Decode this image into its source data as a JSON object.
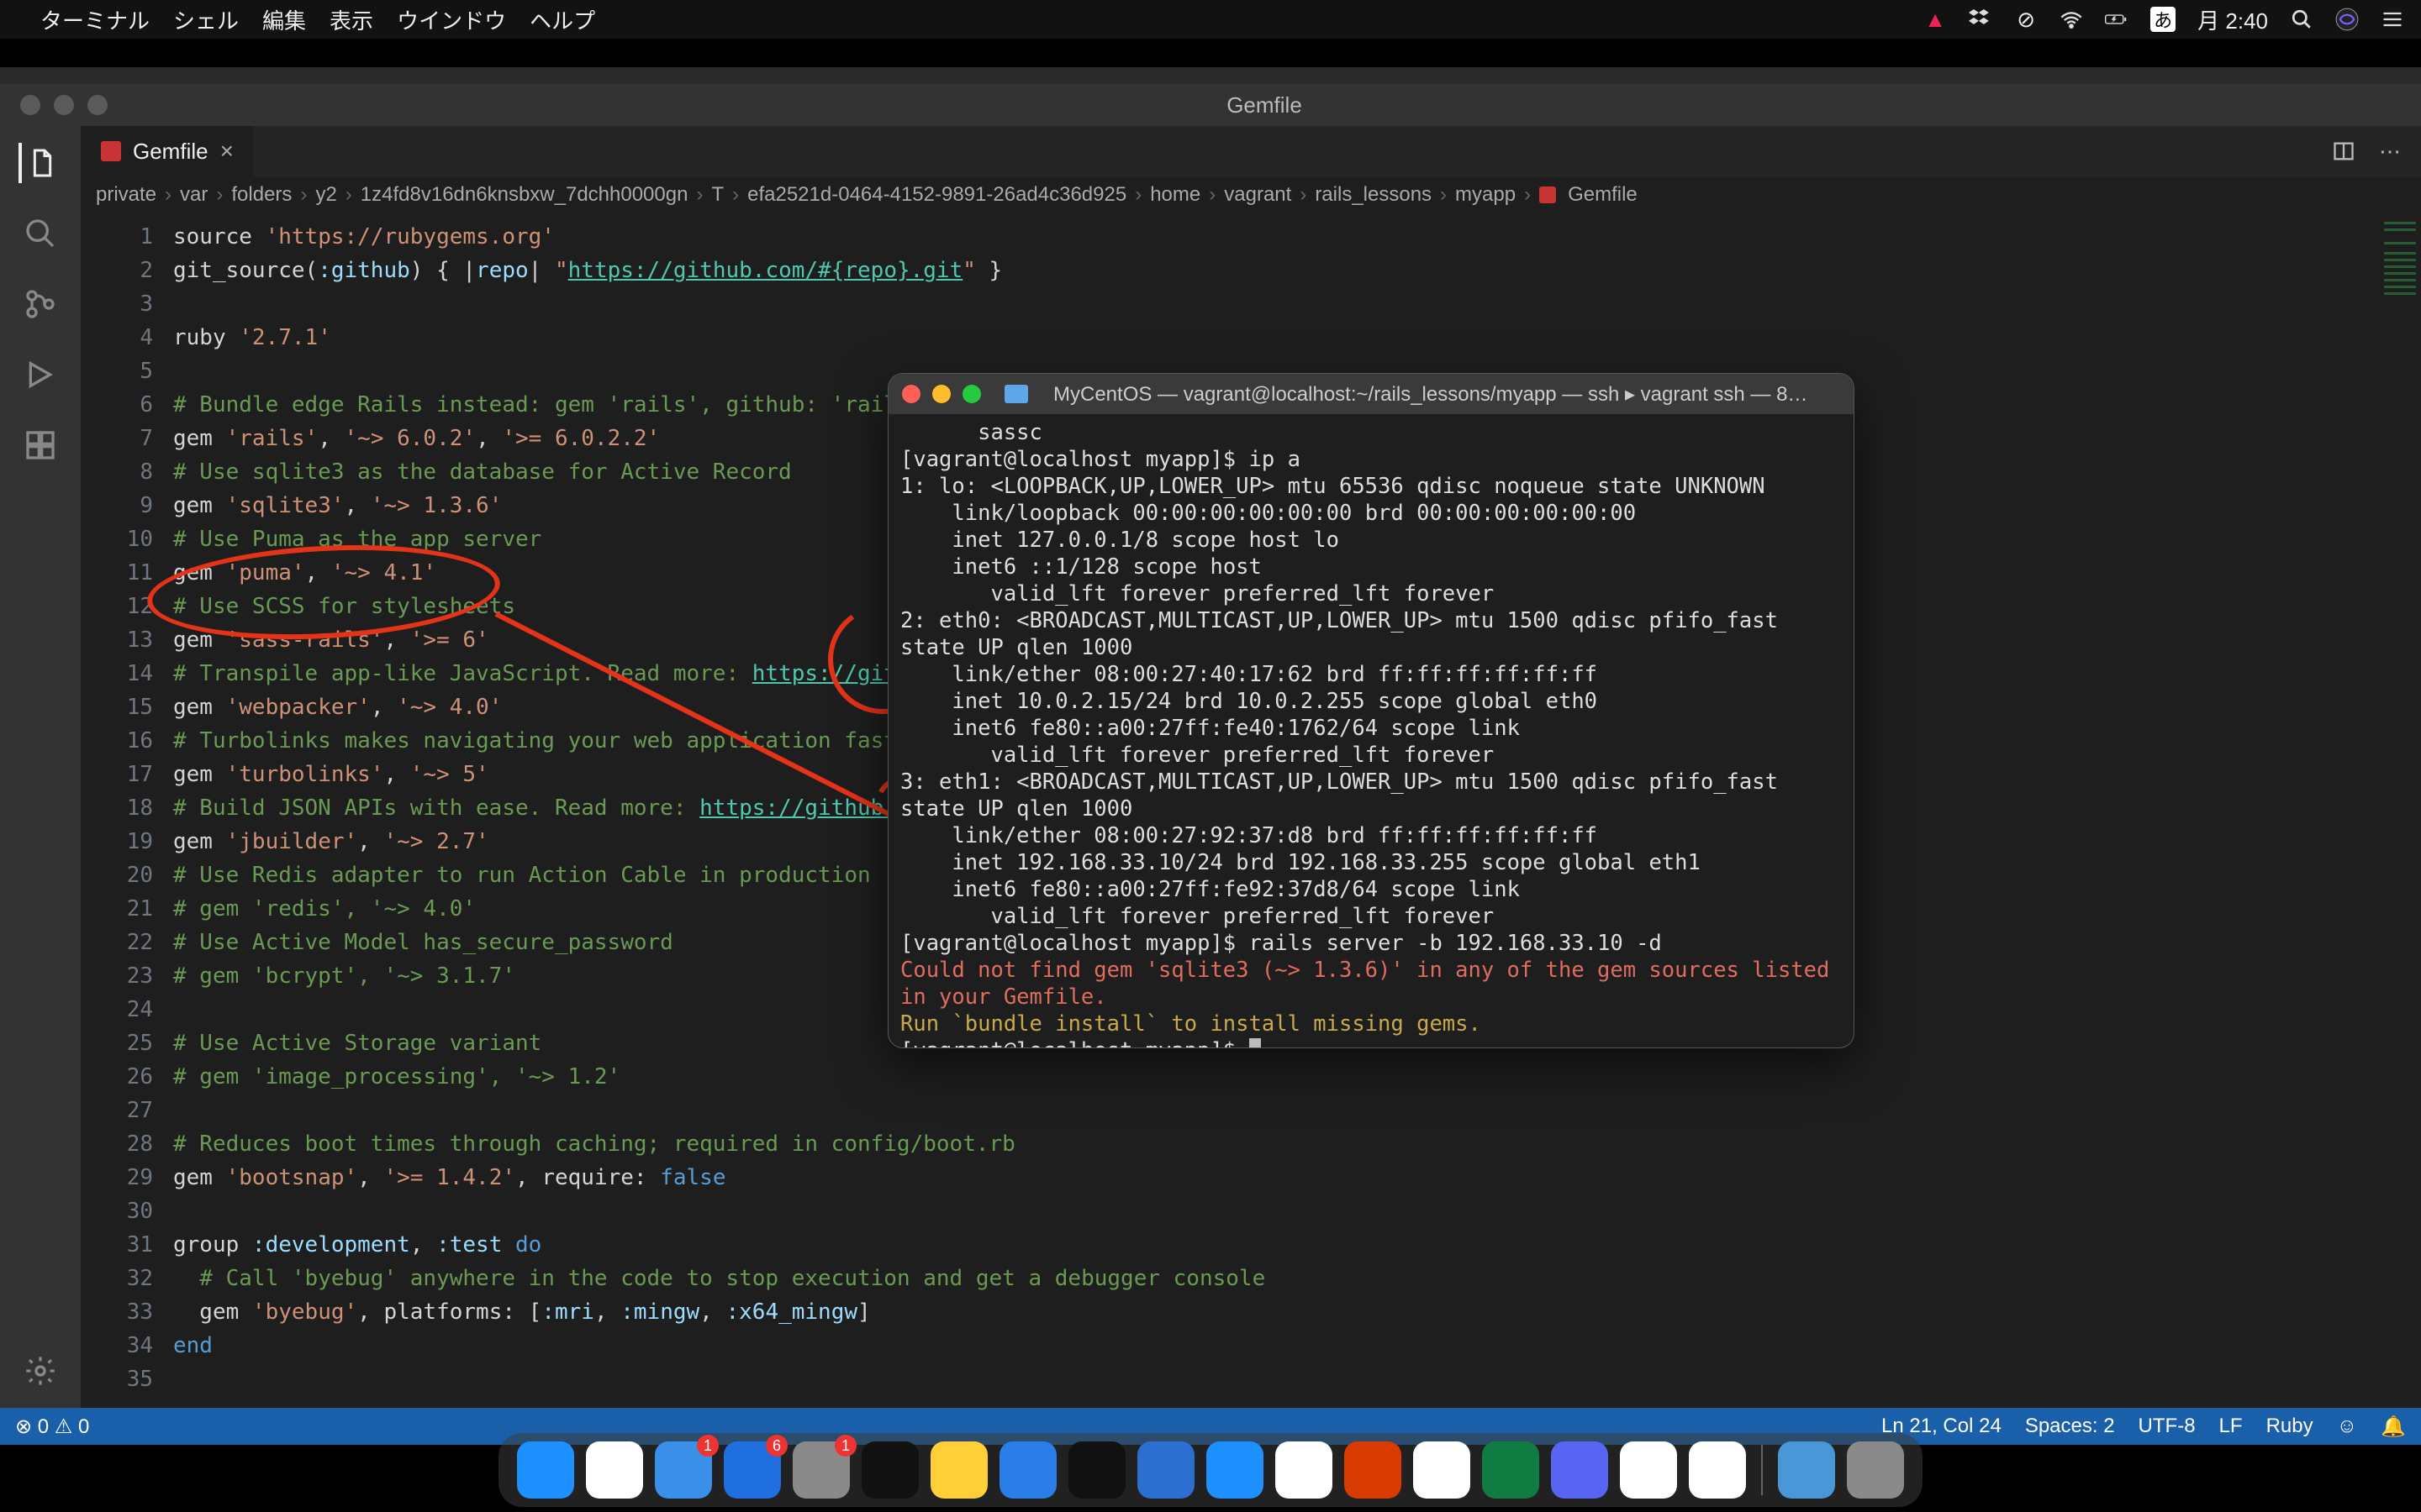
{
  "menubar": {
    "app": "ターミナル",
    "items": [
      "シェル",
      "編集",
      "表示",
      "ウインドウ",
      "ヘルプ"
    ],
    "clock": "月 2:40",
    "input_indicator": "あ"
  },
  "vscode": {
    "window_title": "Gemfile",
    "tab": {
      "label": "Gemfile"
    },
    "breadcrumb": [
      "private",
      "var",
      "folders",
      "y2",
      "1z4fd8v16dn6knsbxw_7dchh0000gn",
      "T",
      "efa2521d-0464-4152-9891-26ad4c36d925",
      "home",
      "vagrant",
      "rails_lessons",
      "myapp",
      "Gemfile"
    ],
    "code_lines": [
      {
        "n": 1,
        "segs": [
          [
            "sym",
            "source "
          ],
          [
            "str",
            "'https://rubygems.org'"
          ]
        ]
      },
      {
        "n": 2,
        "segs": [
          [
            "sym",
            "git_source("
          ],
          [
            "con",
            ":github"
          ],
          [
            "sym",
            ") { |"
          ],
          [
            "con",
            "repo"
          ],
          [
            "sym",
            "| "
          ],
          [
            "str",
            "\""
          ],
          [
            "link",
            "https://github.com/#{repo}.git"
          ],
          [
            "str",
            "\""
          ],
          [
            "sym",
            " }"
          ]
        ]
      },
      {
        "n": 3,
        "segs": [
          [
            "sym",
            ""
          ]
        ]
      },
      {
        "n": 4,
        "segs": [
          [
            "sym",
            "ruby "
          ],
          [
            "str",
            "'2.7.1'"
          ]
        ]
      },
      {
        "n": 5,
        "segs": [
          [
            "sym",
            ""
          ]
        ]
      },
      {
        "n": 6,
        "segs": [
          [
            "cmt",
            "# Bundle edge Rails instead: gem 'rails', github: 'rails/r"
          ]
        ]
      },
      {
        "n": 7,
        "segs": [
          [
            "sym",
            "gem "
          ],
          [
            "str",
            "'rails'"
          ],
          [
            "sym",
            ", "
          ],
          [
            "str",
            "'~> 6.0.2'"
          ],
          [
            "sym",
            ", "
          ],
          [
            "str",
            "'>= 6.0.2.2'"
          ]
        ]
      },
      {
        "n": 8,
        "segs": [
          [
            "cmt",
            "# Use sqlite3 as the database for Active Record"
          ]
        ]
      },
      {
        "n": 9,
        "segs": [
          [
            "sym",
            "gem "
          ],
          [
            "str",
            "'sqlite3'"
          ],
          [
            "sym",
            ", "
          ],
          [
            "str",
            "'~> 1.3.6'"
          ]
        ]
      },
      {
        "n": 10,
        "segs": [
          [
            "cmt",
            "# Use Puma as the app server"
          ]
        ]
      },
      {
        "n": 11,
        "segs": [
          [
            "sym",
            "gem "
          ],
          [
            "str",
            "'puma'"
          ],
          [
            "sym",
            ", "
          ],
          [
            "str",
            "'~> 4.1'"
          ]
        ]
      },
      {
        "n": 12,
        "segs": [
          [
            "cmt",
            "# Use SCSS for stylesheets"
          ]
        ]
      },
      {
        "n": 13,
        "segs": [
          [
            "sym",
            "gem "
          ],
          [
            "str",
            "'sass-rails'"
          ],
          [
            "sym",
            ", "
          ],
          [
            "str",
            "'>= 6'"
          ]
        ]
      },
      {
        "n": 14,
        "segs": [
          [
            "cmt",
            "# Transpile app-like JavaScript. Read more: "
          ],
          [
            "link",
            "https://github.com"
          ]
        ]
      },
      {
        "n": 15,
        "segs": [
          [
            "sym",
            "gem "
          ],
          [
            "str",
            "'webpacker'"
          ],
          [
            "sym",
            ", "
          ],
          [
            "str",
            "'~> 4.0'"
          ]
        ]
      },
      {
        "n": 16,
        "segs": [
          [
            "cmt",
            "# Turbolinks makes navigating your web application faster"
          ]
        ]
      },
      {
        "n": 17,
        "segs": [
          [
            "sym",
            "gem "
          ],
          [
            "str",
            "'turbolinks'"
          ],
          [
            "sym",
            ", "
          ],
          [
            "str",
            "'~> 5'"
          ]
        ]
      },
      {
        "n": 18,
        "segs": [
          [
            "cmt",
            "# Build JSON APIs with ease. Read more: "
          ],
          [
            "link",
            "https://github.com"
          ]
        ]
      },
      {
        "n": 19,
        "segs": [
          [
            "sym",
            "gem "
          ],
          [
            "str",
            "'jbuilder'"
          ],
          [
            "sym",
            ", "
          ],
          [
            "str",
            "'~> 2.7'"
          ]
        ]
      },
      {
        "n": 20,
        "segs": [
          [
            "cmt",
            "# Use Redis adapter to run Action Cable in production"
          ]
        ]
      },
      {
        "n": 21,
        "segs": [
          [
            "cmt",
            "# gem 'redis', '~> 4.0'"
          ]
        ]
      },
      {
        "n": 22,
        "segs": [
          [
            "cmt",
            "# Use Active Model has_secure_password"
          ]
        ]
      },
      {
        "n": 23,
        "segs": [
          [
            "cmt",
            "# gem 'bcrypt', '~> 3.1.7'"
          ]
        ]
      },
      {
        "n": 24,
        "segs": [
          [
            "sym",
            ""
          ]
        ]
      },
      {
        "n": 25,
        "segs": [
          [
            "cmt",
            "# Use Active Storage variant"
          ]
        ]
      },
      {
        "n": 26,
        "segs": [
          [
            "cmt",
            "# gem 'image_processing', '~> 1.2'"
          ]
        ]
      },
      {
        "n": 27,
        "segs": [
          [
            "sym",
            ""
          ]
        ]
      },
      {
        "n": 28,
        "segs": [
          [
            "cmt",
            "# Reduces boot times through caching; required in config/boot.rb"
          ]
        ]
      },
      {
        "n": 29,
        "segs": [
          [
            "sym",
            "gem "
          ],
          [
            "str",
            "'bootsnap'"
          ],
          [
            "sym",
            ", "
          ],
          [
            "str",
            "'>= 1.4.2'"
          ],
          [
            "sym",
            ", require: "
          ],
          [
            "kw",
            "false"
          ]
        ]
      },
      {
        "n": 30,
        "segs": [
          [
            "sym",
            ""
          ]
        ]
      },
      {
        "n": 31,
        "segs": [
          [
            "sym",
            "group "
          ],
          [
            "con",
            ":development"
          ],
          [
            "sym",
            ", "
          ],
          [
            "con",
            ":test"
          ],
          [
            "sym",
            " "
          ],
          [
            "kw",
            "do"
          ]
        ]
      },
      {
        "n": 32,
        "segs": [
          [
            "sym",
            "  "
          ],
          [
            "cmt",
            "# Call 'byebug' anywhere in the code to stop execution and get a debugger console"
          ]
        ]
      },
      {
        "n": 33,
        "segs": [
          [
            "sym",
            "  gem "
          ],
          [
            "str",
            "'byebug'"
          ],
          [
            "sym",
            ", platforms: ["
          ],
          [
            "con",
            ":mri"
          ],
          [
            "sym",
            ", "
          ],
          [
            "con",
            ":mingw"
          ],
          [
            "sym",
            ", "
          ],
          [
            "con",
            ":x64_mingw"
          ],
          [
            "sym",
            "]"
          ]
        ]
      },
      {
        "n": 34,
        "segs": [
          [
            "kw",
            "end"
          ]
        ]
      },
      {
        "n": 35,
        "segs": [
          [
            "sym",
            ""
          ]
        ]
      }
    ],
    "status": {
      "errors": "0",
      "warnings": "0",
      "ln_col": "Ln 21, Col 24",
      "spaces": "Spaces: 2",
      "encoding": "UTF-8",
      "eol": "LF",
      "language": "Ruby"
    }
  },
  "terminal": {
    "title": "MyCentOS — vagrant@localhost:~/rails_lessons/myapp — ssh ▸ vagrant ssh — 8…",
    "lines": [
      {
        "cls": "",
        "t": "      sassc"
      },
      {
        "cls": "",
        "t": "[vagrant@localhost myapp]$ ip a"
      },
      {
        "cls": "",
        "t": "1: lo: <LOOPBACK,UP,LOWER_UP> mtu 65536 qdisc noqueue state UNKNOWN"
      },
      {
        "cls": "",
        "t": "    link/loopback 00:00:00:00:00:00 brd 00:00:00:00:00:00"
      },
      {
        "cls": "",
        "t": "    inet 127.0.0.1/8 scope host lo"
      },
      {
        "cls": "",
        "t": "    inet6 ::1/128 scope host"
      },
      {
        "cls": "",
        "t": "       valid_lft forever preferred_lft forever"
      },
      {
        "cls": "",
        "t": "2: eth0: <BROADCAST,MULTICAST,UP,LOWER_UP> mtu 1500 qdisc pfifo_fast state UP qlen 1000"
      },
      {
        "cls": "",
        "t": "    link/ether 08:00:27:40:17:62 brd ff:ff:ff:ff:ff:ff"
      },
      {
        "cls": "",
        "t": "    inet 10.0.2.15/24 brd 10.0.2.255 scope global eth0"
      },
      {
        "cls": "",
        "t": "    inet6 fe80::a00:27ff:fe40:1762/64 scope link"
      },
      {
        "cls": "",
        "t": "       valid_lft forever preferred_lft forever"
      },
      {
        "cls": "",
        "t": "3: eth1: <BROADCAST,MULTICAST,UP,LOWER_UP> mtu 1500 qdisc pfifo_fast state UP qlen 1000"
      },
      {
        "cls": "",
        "t": "    link/ether 08:00:27:92:37:d8 brd ff:ff:ff:ff:ff:ff"
      },
      {
        "cls": "",
        "t": "    inet 192.168.33.10/24 brd 192.168.33.255 scope global eth1"
      },
      {
        "cls": "",
        "t": "    inet6 fe80::a00:27ff:fe92:37d8/64 scope link"
      },
      {
        "cls": "",
        "t": "       valid_lft forever preferred_lft forever"
      },
      {
        "cls": "",
        "t": "[vagrant@localhost myapp]$ rails server -b 192.168.33.10 -d"
      },
      {
        "cls": "t-red",
        "t": "Could not find gem 'sqlite3 (~> 1.3.6)' in any of the gem sources listed in your Gemfile."
      },
      {
        "cls": "t-yel",
        "t": "Run `bundle install` to install missing gems."
      },
      {
        "cls": "",
        "t": "[vagrant@localhost myapp]$ "
      }
    ]
  },
  "dock": {
    "items": [
      {
        "name": "finder",
        "color": "#1e90ff"
      },
      {
        "name": "chrome",
        "color": "#fff"
      },
      {
        "name": "mail",
        "color": "#3a8fe8",
        "badge": "1"
      },
      {
        "name": "appstore",
        "color": "#1f6fe0",
        "badge": "6"
      },
      {
        "name": "sysprefs",
        "color": "#8a8a8a",
        "badge": "1"
      },
      {
        "name": "terminal",
        "color": "#111"
      },
      {
        "name": "duck",
        "color": "#ffcf3a"
      },
      {
        "name": "vscode",
        "color": "#2b7de8"
      },
      {
        "name": "iterm",
        "color": "#111"
      },
      {
        "name": "ms-todo",
        "color": "#2c6fd1"
      },
      {
        "name": "finder-window",
        "color": "#1e90ff"
      },
      {
        "name": "photos",
        "color": "#fff"
      },
      {
        "name": "office",
        "color": "#d83b01"
      },
      {
        "name": "slack",
        "color": "#fff",
        "badge": ""
      },
      {
        "name": "excel",
        "color": "#107c41"
      },
      {
        "name": "discord",
        "color": "#5865f2"
      },
      {
        "name": "ie",
        "color": "#fff"
      },
      {
        "name": "tasks",
        "color": "#fff"
      }
    ],
    "right": [
      {
        "name": "folder",
        "color": "#4a97d8"
      },
      {
        "name": "trash",
        "color": "#8a8a8a"
      }
    ]
  }
}
